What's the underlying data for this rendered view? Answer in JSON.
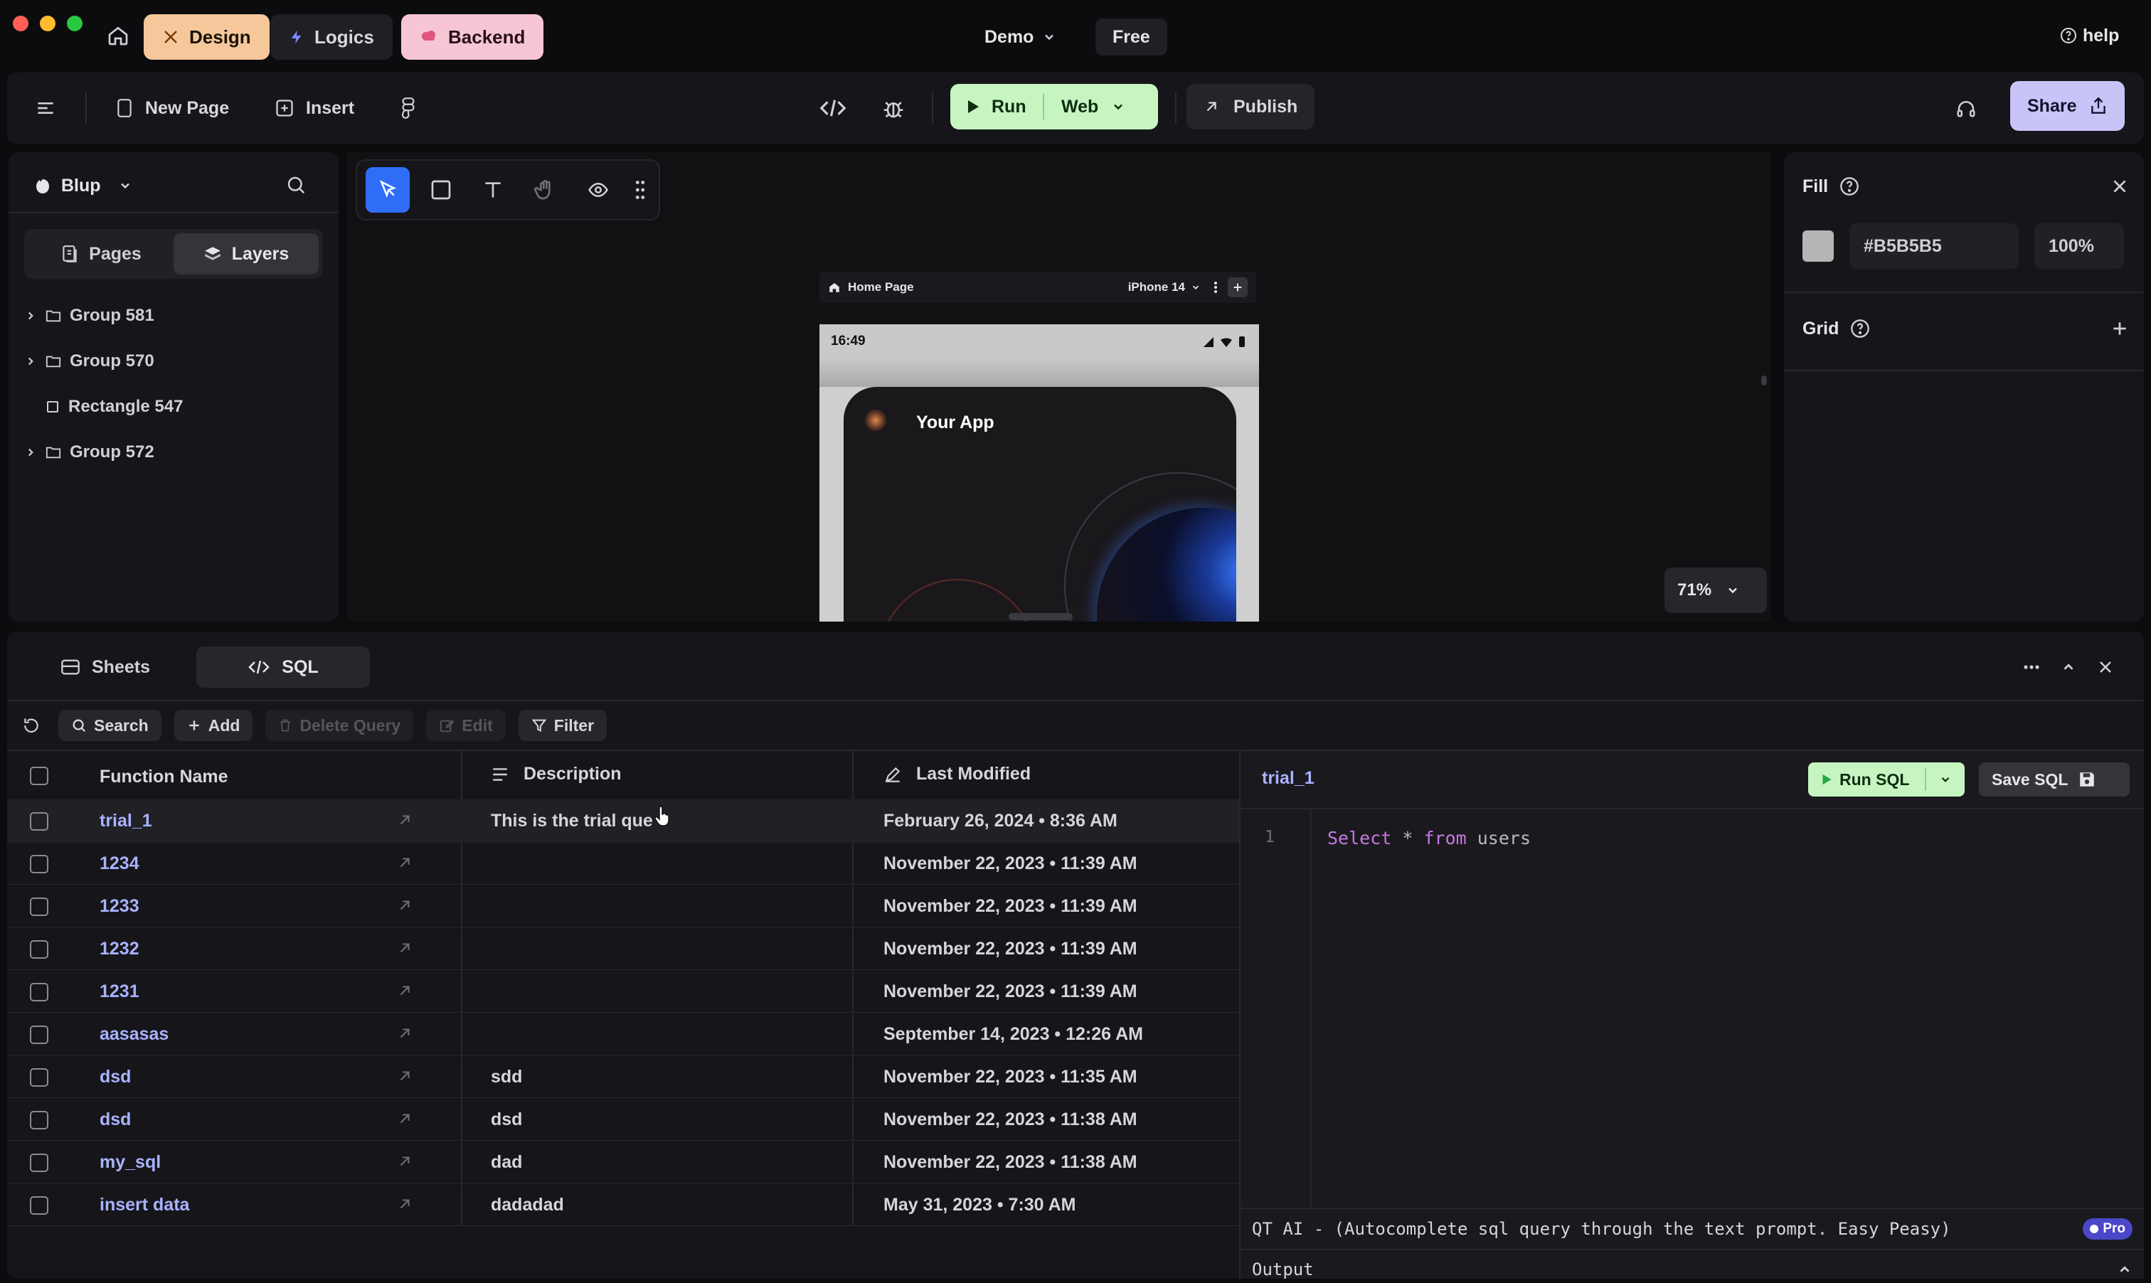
{
  "titlebar": {
    "tabs": [
      {
        "label": "Design",
        "icon": "design-icon"
      },
      {
        "label": "Logics",
        "icon": "lightning-icon"
      },
      {
        "label": "Backend",
        "icon": "cloud-icon"
      }
    ],
    "project": "Demo",
    "plan": "Free",
    "help": "help"
  },
  "toolbar": {
    "new_page": "New Page",
    "insert": "Insert",
    "run": "Run",
    "run_target": "Web",
    "publish": "Publish",
    "share": "Share"
  },
  "left_panel": {
    "workspace": "Blup",
    "tabs": [
      "Pages",
      "Layers"
    ],
    "layers": [
      {
        "label": "Group 581",
        "expandable": true
      },
      {
        "label": "Group 570",
        "expandable": true
      },
      {
        "label": "Rectangle 547",
        "expandable": false
      },
      {
        "label": "Group 572",
        "expandable": true
      }
    ]
  },
  "canvas": {
    "page_name": "Home Page",
    "device": "iPhone 14",
    "phone_time": "16:49",
    "app_title": "Your App",
    "zoom": "71%"
  },
  "right_panel": {
    "fill_label": "Fill",
    "fill_color": "#B5B5B5",
    "fill_opacity": "100%",
    "grid_label": "Grid"
  },
  "bottom": {
    "tabs": [
      "Sheets",
      "SQL"
    ],
    "actions": {
      "search": "Search",
      "add": "Add",
      "delete": "Delete Query",
      "edit": "Edit",
      "filter": "Filter"
    },
    "columns": [
      "Function Name",
      "Description",
      "Last Modified"
    ],
    "rows": [
      {
        "name": "trial_1",
        "description": "This is the trial que",
        "modified": "February 26, 2024 • 8:36 AM"
      },
      {
        "name": "1234",
        "description": "",
        "modified": "November 22, 2023 • 11:39 AM"
      },
      {
        "name": "1233",
        "description": "",
        "modified": "November 22, 2023 • 11:39 AM"
      },
      {
        "name": "1232",
        "description": "",
        "modified": "November 22, 2023 • 11:39 AM"
      },
      {
        "name": "1231",
        "description": "",
        "modified": "November 22, 2023 • 11:39 AM"
      },
      {
        "name": "aasasas",
        "description": "",
        "modified": "September 14, 2023 • 12:26 AM"
      },
      {
        "name": "dsd",
        "description": "sdd",
        "modified": "November 22, 2023 • 11:35 AM"
      },
      {
        "name": "dsd",
        "description": "dsd",
        "modified": "November 22, 2023 • 11:38 AM"
      },
      {
        "name": "my_sql",
        "description": "dad",
        "modified": "November 22, 2023 • 11:38 AM"
      },
      {
        "name": "insert data",
        "description": "dadadad",
        "modified": "May 31, 2023 • 7:30 AM"
      }
    ],
    "editor": {
      "query_name": "trial_1",
      "run_sql": "Run SQL",
      "save_sql": "Save SQL",
      "line_number": "1",
      "code_kw1": "Select",
      "code_mid": " * ",
      "code_kw2": "from",
      "code_tail": " users",
      "ai_prompt": "QT AI - (Autocomplete sql query through the text prompt. Easy Peasy)",
      "pro_badge": "Pro",
      "output_label": "Output"
    }
  },
  "colors": {
    "design_tab": "#f5c79a",
    "backend_tab": "#f7c6d4",
    "run_button": "#c6f5c2",
    "share_button": "#c9c4f7",
    "accent_blue": "#2f6df6",
    "sql_keyword": "#c678dd"
  }
}
